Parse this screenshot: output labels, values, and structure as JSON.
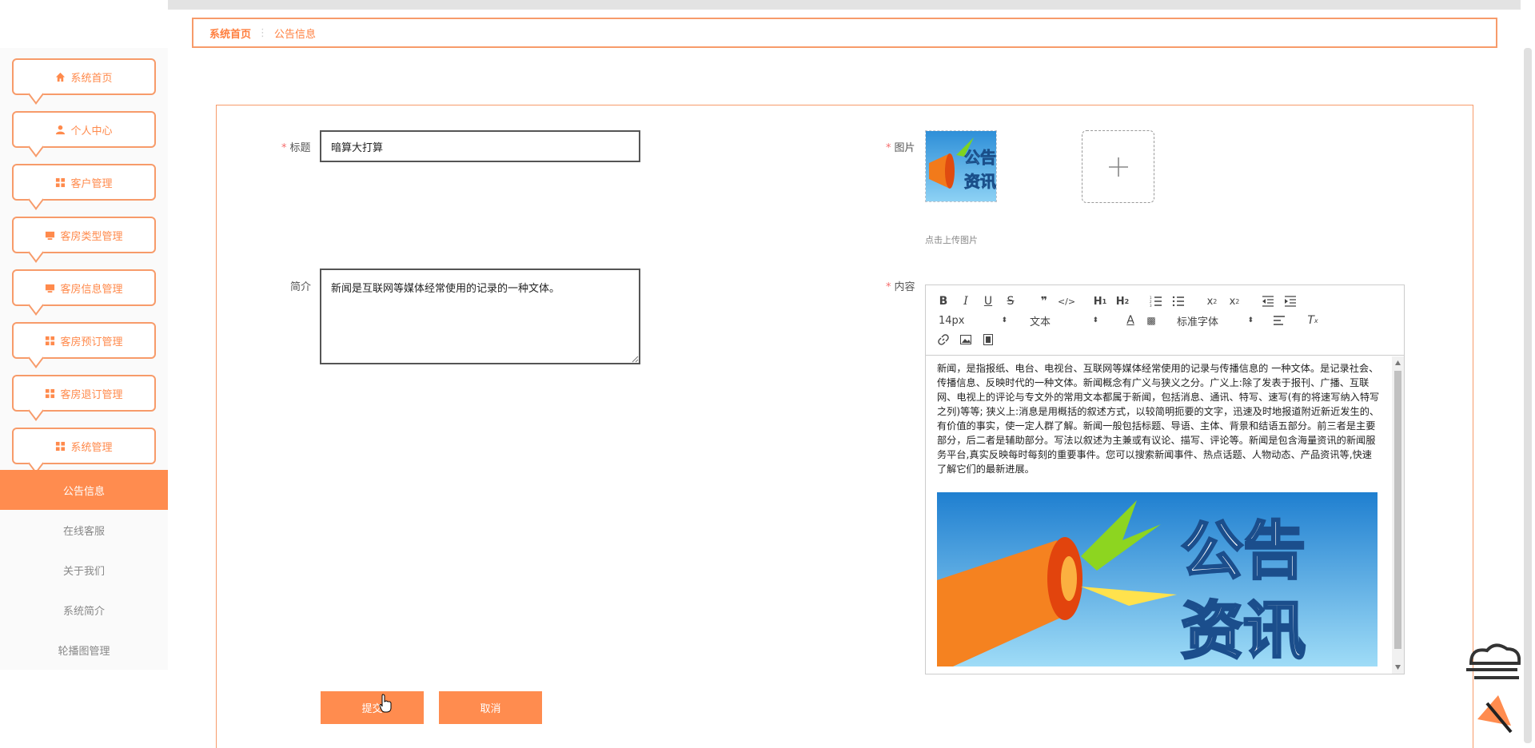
{
  "sidebar": {
    "menu": [
      {
        "label": "系统首页",
        "icon": "home-icon"
      },
      {
        "label": "个人中心",
        "icon": "user-icon"
      },
      {
        "label": "客户管理",
        "icon": "grid-icon"
      },
      {
        "label": "客房类型管理",
        "icon": "monitor-icon"
      },
      {
        "label": "客房信息管理",
        "icon": "monitor-icon"
      },
      {
        "label": "客房预订管理",
        "icon": "grid-icon"
      },
      {
        "label": "客房退订管理",
        "icon": "grid-icon"
      },
      {
        "label": "系统管理",
        "icon": "grid-icon"
      }
    ],
    "sub_items": [
      {
        "label": "公告信息",
        "active": true
      },
      {
        "label": "在线客服",
        "active": false
      },
      {
        "label": "关于我们",
        "active": false
      },
      {
        "label": "系统简介",
        "active": false
      },
      {
        "label": "轮播图管理",
        "active": false
      }
    ]
  },
  "breadcrumb": {
    "home": "系统首页",
    "current": "公告信息"
  },
  "form": {
    "title_label": "标题",
    "title_value": "暗算大打算",
    "intro_label": "简介",
    "intro_value": "新闻是互联网等媒体经常使用的记录的一种文体。",
    "image_label": "图片",
    "upload_hint": "点击上传图片",
    "content_label": "内容",
    "required_mark": "*",
    "submit_label": "提交",
    "cancel_label": "取消"
  },
  "editor": {
    "font_size": "14px",
    "block_type": "文本",
    "font_family": "标准字体",
    "content_text": "新闻，是指报纸、电台、电视台、互联网等媒体经常使用的记录与传播信息的 一种文体。是记录社会、传播信息、反映时代的一种文体。新闻概念有广义与狭义之分。广义上:除了发表于报刊、广播、互联网、电视上的评论与专文外的常用文本都属于新闻，包括消息、通讯、特写、速写(有的将速写纳入特写之列)等等; 狭义上:消息是用概括的叙述方式，以较简明扼要的文字，迅速及时地报道附近新近发生的、有价值的事实，使一定人群了解。新闻一般包括标题、导语、主体、背景和结语五部分。前三者是主要部分，后二者是辅助部分。写法以叙述为主兼或有议论、描写、评论等。新闻是包含海量资讯的新闻服务平台,真实反映每时每刻的重要事件。您可以搜索新闻事件、热点话题、人物动态、产品资讯等,快速了解它们的最新进展。",
    "image_text_line1": "公告",
    "image_text_line2": "资讯"
  },
  "thumb": {
    "line1": "公告",
    "line2": "资讯"
  },
  "colors": {
    "accent": "#ff8c4f",
    "border": "#f79b6a",
    "required": "#f56c6c"
  }
}
